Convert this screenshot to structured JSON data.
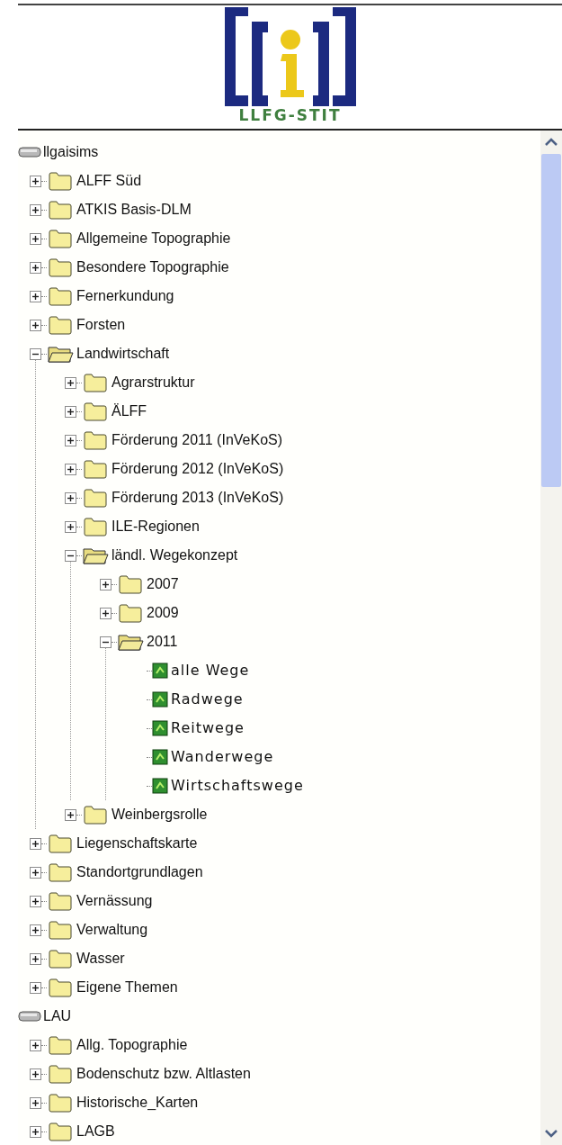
{
  "logo": {
    "caption": "LLFG-STIT"
  },
  "tree": [
    {
      "label": "llgaisims",
      "kind": "drive",
      "children": [
        {
          "label": "ALFF Süd",
          "kind": "folder",
          "expanded": false
        },
        {
          "label": "ATKIS Basis-DLM",
          "kind": "folder",
          "expanded": false
        },
        {
          "label": "Allgemeine Topographie",
          "kind": "folder",
          "expanded": false
        },
        {
          "label": "Besondere Topographie",
          "kind": "folder",
          "expanded": false
        },
        {
          "label": "Fernerkundung",
          "kind": "folder",
          "expanded": false
        },
        {
          "label": "Forsten",
          "kind": "folder",
          "expanded": false
        },
        {
          "label": "Landwirtschaft",
          "kind": "folder",
          "expanded": true,
          "children": [
            {
              "label": "Agrarstruktur",
              "kind": "folder",
              "expanded": false
            },
            {
              "label": "ÄLFF",
              "kind": "folder",
              "expanded": false
            },
            {
              "label": "Förderung 2011 (InVeKoS)",
              "kind": "folder",
              "expanded": false
            },
            {
              "label": "Förderung 2012 (InVeKoS)",
              "kind": "folder",
              "expanded": false
            },
            {
              "label": "Förderung 2013 (InVeKoS)",
              "kind": "folder",
              "expanded": false
            },
            {
              "label": "ILE-Regionen",
              "kind": "folder",
              "expanded": false
            },
            {
              "label": "ländl. Wegekonzept",
              "kind": "folder",
              "expanded": true,
              "children": [
                {
                  "label": "2007",
                  "kind": "folder",
                  "expanded": false
                },
                {
                  "label": "2009",
                  "kind": "folder",
                  "expanded": false
                },
                {
                  "label": "2011",
                  "kind": "folder",
                  "expanded": true,
                  "children": [
                    {
                      "label": "alle Wege",
                      "kind": "layer"
                    },
                    {
                      "label": "Radwege",
                      "kind": "layer"
                    },
                    {
                      "label": "Reitwege",
                      "kind": "layer"
                    },
                    {
                      "label": "Wanderwege",
                      "kind": "layer"
                    },
                    {
                      "label": "Wirtschaftswege",
                      "kind": "layer"
                    }
                  ]
                }
              ]
            },
            {
              "label": "Weinbergsrolle",
              "kind": "folder",
              "expanded": false
            }
          ]
        },
        {
          "label": "Liegenschaftskarte",
          "kind": "folder",
          "expanded": false
        },
        {
          "label": "Standortgrundlagen",
          "kind": "folder",
          "expanded": false
        },
        {
          "label": "Vernässung",
          "kind": "folder",
          "expanded": false
        },
        {
          "label": "Verwaltung",
          "kind": "folder",
          "expanded": false
        },
        {
          "label": "Wasser",
          "kind": "folder",
          "expanded": false
        },
        {
          "label": "Eigene Themen",
          "kind": "folder",
          "expanded": false
        }
      ]
    },
    {
      "label": "LAU",
      "kind": "drive",
      "children": [
        {
          "label": "Allg. Topographie",
          "kind": "folder",
          "expanded": false
        },
        {
          "label": "Bodenschutz bzw. Altlasten",
          "kind": "folder",
          "expanded": false
        },
        {
          "label": "Historische_Karten",
          "kind": "folder",
          "expanded": false
        },
        {
          "label": "LAGB",
          "kind": "folder",
          "expanded": false
        }
      ]
    }
  ]
}
